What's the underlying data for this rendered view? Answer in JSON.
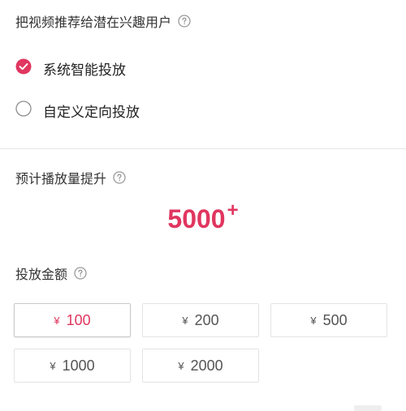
{
  "target_section": {
    "title": "把视频推荐给潜在兴趣用户",
    "options": [
      {
        "label": "系统智能投放",
        "selected": true
      },
      {
        "label": "自定义定向投放",
        "selected": false
      }
    ]
  },
  "estimate_section": {
    "title": "预计播放量提升",
    "value": "5000",
    "suffix": "+"
  },
  "amount_section": {
    "title": "投放金额",
    "currency_symbol": "¥",
    "amounts": [
      "100",
      "200",
      "500",
      "1000",
      "2000"
    ],
    "selected_amount": "100"
  },
  "colors": {
    "accent": "#e0365f",
    "border": "#e3e3e3",
    "muted_icon": "#9a9a9a"
  },
  "icons": [
    "help-circle-icon",
    "check-circle-icon",
    "radio-empty-icon"
  ]
}
